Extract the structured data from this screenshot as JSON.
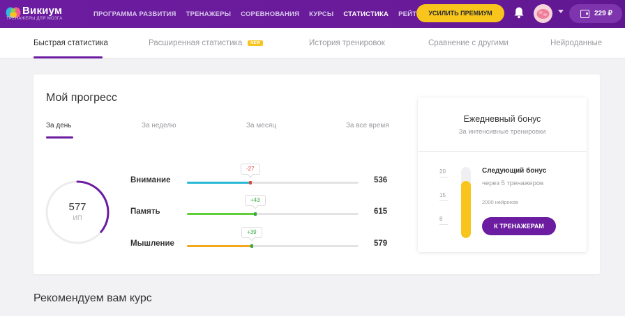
{
  "header": {
    "logo_name": "Викиум",
    "logo_sub": "ТРЕНАЖЕРЫ ДЛЯ МОЗГА",
    "nav": [
      {
        "label": "ПРОГРАММА РАЗВИТИЯ",
        "active": false
      },
      {
        "label": "ТРЕНАЖЕРЫ",
        "active": false
      },
      {
        "label": "СОРЕВНОВАНИЯ",
        "active": false
      },
      {
        "label": "КУРСЫ",
        "active": false
      },
      {
        "label": "СТАТИСТИКА",
        "active": true
      },
      {
        "label": "РЕЙТИНГ",
        "active": false
      }
    ],
    "premium_button": "УСИЛИТЬ ПРЕМИУМ",
    "wallet_amount": "229 ₽",
    "colors": {
      "brand": "#6b1ca0",
      "accent": "#f7c51c"
    }
  },
  "tabs": {
    "items": [
      {
        "label": "Быстрая статистика",
        "active": true
      },
      {
        "label": "Расширенная статистика",
        "active": false,
        "badge": "NEW"
      },
      {
        "label": "История тренировок",
        "active": false
      },
      {
        "label": "Сравнение с другими",
        "active": false
      },
      {
        "label": "Нейроданные",
        "active": false
      }
    ]
  },
  "progress": {
    "title": "Мой прогресс",
    "periods": [
      {
        "label": "За день",
        "active": true
      },
      {
        "label": "За неделю",
        "active": false
      },
      {
        "label": "За месяц",
        "active": false
      },
      {
        "label": "За все время",
        "active": false
      }
    ],
    "total": {
      "value": "577",
      "unit": "ИП",
      "gauge_fraction": 0.36
    },
    "skills": [
      {
        "label": "Внимание",
        "score": "536",
        "change": "-27",
        "direction": "down",
        "fill_fraction": 0.37,
        "color": "#26b8d4",
        "knob_color": "#e0463c"
      },
      {
        "label": "Память",
        "score": "615",
        "change": "+43",
        "direction": "up",
        "fill_fraction": 0.4,
        "color": "#5fcf3a",
        "knob_color": "#3aa744"
      },
      {
        "label": "Мышление",
        "score": "579",
        "change": "+39",
        "direction": "up",
        "fill_fraction": 0.38,
        "color": "#f2a81d",
        "knob_color": "#3aa744"
      }
    ]
  },
  "bonus": {
    "title": "Ежедневный бонус",
    "subtitle": "За интенсивные тренировки",
    "scale": [
      "20",
      "15",
      "8"
    ],
    "fill_fraction": 0.8,
    "next_title": "Следующий бонус",
    "next_sub": "через 5 тренажеров",
    "neurons": "2000 нейронов",
    "button": "К ТРЕНАЖЕРАМ"
  },
  "recommend": {
    "title": "Рекомендуем вам курс"
  }
}
